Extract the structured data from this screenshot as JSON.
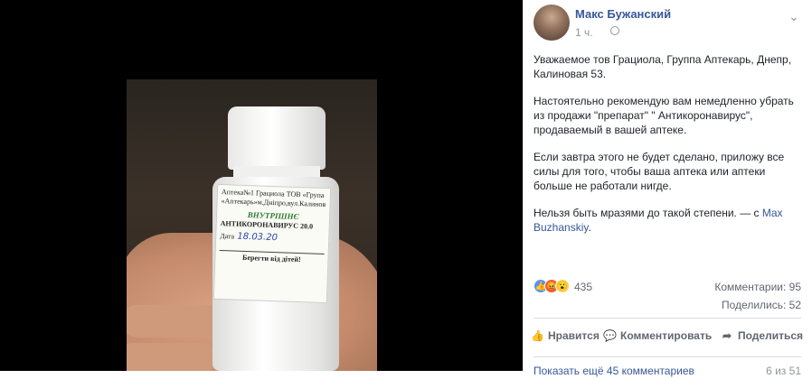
{
  "photo": {
    "label": {
      "line1": "Аптека№1 Грациола ТОВ «Група",
      "line2": "«Аптекарь»м.Дніпро,вул.Калинова,53",
      "inner": "ВНУТРІШНЄ",
      "name": "АНТИКОРОНАВИРУС",
      "qty": "20.0",
      "date_label": "Дата",
      "date_value": "18.03.20",
      "warning": "Берегти від дітей!"
    }
  },
  "post": {
    "author": "Макс Бужанский",
    "time": "1 ч.",
    "paragraphs": [
      "Уважаемое тов Грациола, Группа Аптекарь, Днепр, Калиновая 53.",
      "Настоятельно рекомендую вам немедленно убрать из продажи \"препарат\" \" Антикоронавирус\", продаваемый в вашей аптеке.",
      "Если завтра этого не будет сделано, приложу все силы для того, чтобы ваша аптека или аптеки больше не работали нигде."
    ],
    "last_paragraph": "Нельзя быть мразями до такой степени. — с",
    "tagged": "Max Buzhanskiy",
    "tagged_suffix": "."
  },
  "stats": {
    "reactions": "435",
    "comments": "Комментарии: 95",
    "shares": "Поделились: 52"
  },
  "actions": {
    "like": "Нравится",
    "comment": "Комментировать",
    "share": "Поделиться"
  },
  "footer": {
    "more_comments": "Показать ещё 45 комментариев",
    "pager": "6 из 51"
  },
  "icons": {
    "like": "thumbs-up-icon",
    "comment": "speech-bubble-icon",
    "share": "share-arrow-icon"
  },
  "colors": {
    "link": "#365899",
    "muted": "#90949c",
    "like_reaction": "#5890ff",
    "angry_reaction": "#f35a34",
    "wow_reaction": "#fcd34a"
  }
}
